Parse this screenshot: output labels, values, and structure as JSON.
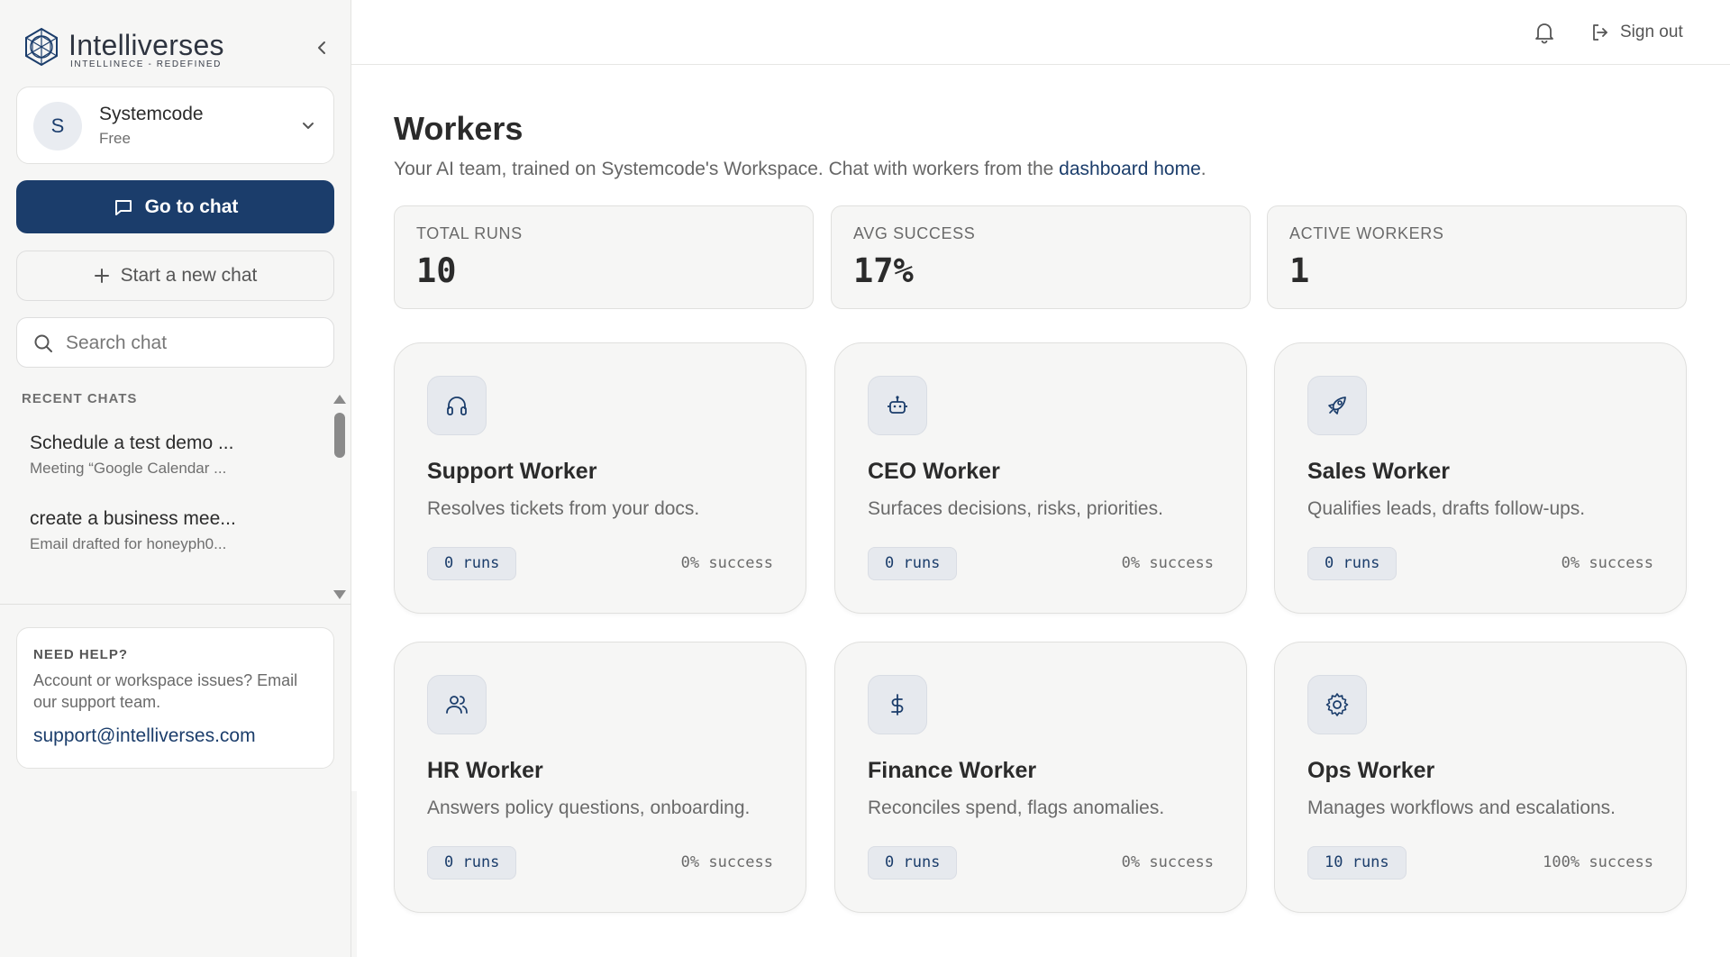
{
  "brand": {
    "name": "Intelliverses",
    "tagline": "INTELLINECE - REDEFINED"
  },
  "workspace": {
    "initial": "S",
    "name": "Systemcode",
    "plan": "Free"
  },
  "sidebar": {
    "go_chat_label": "Go to chat",
    "new_chat_label": "Start a new chat",
    "search_placeholder": "Search chat",
    "recent_label": "RECENT CHATS",
    "recent_chats": [
      {
        "title": "Schedule a test demo ...",
        "subtitle": "Meeting “Google Calendar ..."
      },
      {
        "title": "create a business mee...",
        "subtitle": "Email drafted for honeyph0..."
      }
    ],
    "help": {
      "title": "NEED HELP?",
      "text": "Account or workspace issues? Email our support team.",
      "email": "support@intelliverses.com"
    }
  },
  "topbar": {
    "signout_label": "Sign out"
  },
  "page": {
    "title": "Workers",
    "subtitle_prefix": "Your AI team, trained on Systemcode's Workspace. Chat with workers from the ",
    "subtitle_link": "dashboard home",
    "subtitle_suffix": "."
  },
  "stats": [
    {
      "label": "TOTAL RUNS",
      "value": "10"
    },
    {
      "label": "AVG SUCCESS",
      "value": "17%"
    },
    {
      "label": "ACTIVE WORKERS",
      "value": "1"
    }
  ],
  "workers": [
    {
      "name": "Support Worker",
      "desc": "Resolves tickets from your docs.",
      "runs": "0 runs",
      "success": "0% success",
      "icon": "headphones-icon"
    },
    {
      "name": "CEO Worker",
      "desc": "Surfaces decisions, risks, priorities.",
      "runs": "0 runs",
      "success": "0% success",
      "icon": "robot-icon"
    },
    {
      "name": "Sales Worker",
      "desc": "Qualifies leads, drafts follow-ups.",
      "runs": "0 runs",
      "success": "0% success",
      "icon": "rocket-icon"
    },
    {
      "name": "HR Worker",
      "desc": "Answers policy questions, onboarding.",
      "runs": "0 runs",
      "success": "0% success",
      "icon": "users-icon"
    },
    {
      "name": "Finance Worker",
      "desc": "Reconciles spend, flags anomalies.",
      "runs": "0 runs",
      "success": "0% success",
      "icon": "dollar-icon"
    },
    {
      "name": "Ops Worker",
      "desc": "Manages workflows and escalations.",
      "runs": "10 runs",
      "success": "100% success",
      "icon": "gear-icon"
    }
  ],
  "colors": {
    "primary": "#1b3d6b",
    "sidebar_bg": "#f6f6f5",
    "card_bg": "#f6f6f5"
  }
}
